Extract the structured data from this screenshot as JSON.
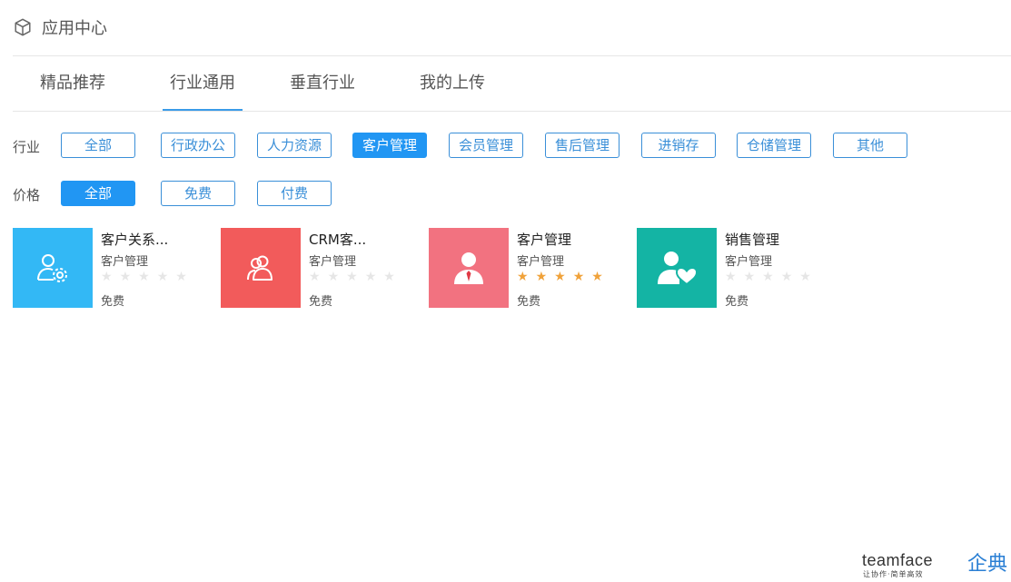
{
  "header": {
    "title": "应用中心",
    "icon": "cube-icon"
  },
  "tabs": [
    {
      "label": "精品推荐",
      "active": false
    },
    {
      "label": "行业通用",
      "active": true
    },
    {
      "label": "垂直行业",
      "active": false
    },
    {
      "label": "我的上传",
      "active": false
    }
  ],
  "filters": {
    "industry": {
      "label": "行业",
      "options": [
        "全部",
        "行政办公",
        "人力资源",
        "客户管理",
        "会员管理",
        "售后管理",
        "进销存",
        "仓储管理",
        "其他"
      ],
      "selected": "客户管理"
    },
    "price": {
      "label": "价格",
      "options": [
        "全部",
        "免费",
        "付费"
      ],
      "selected": "全部"
    }
  },
  "apps": [
    {
      "name": "客户关系...",
      "category": "客户管理",
      "rating": 0,
      "max_rating": 5,
      "price": "免费",
      "color": "#33b8f5",
      "icon": "user-settings-icon"
    },
    {
      "name": "CRM客...",
      "category": "客户管理",
      "rating": 0,
      "max_rating": 5,
      "price": "免费",
      "color": "#f25b5b",
      "icon": "users-icon"
    },
    {
      "name": "客户管理",
      "category": "客户管理",
      "rating": 5,
      "max_rating": 5,
      "price": "免费",
      "color": "#f27280",
      "icon": "businessman-icon"
    },
    {
      "name": "销售管理",
      "category": "客户管理",
      "rating": 0,
      "max_rating": 5,
      "price": "免费",
      "color": "#14b4a4",
      "icon": "user-heart-icon"
    }
  ],
  "brand": {
    "name": "teamface",
    "chinese": "企典",
    "slogan": "让协作·简单高效"
  },
  "colors": {
    "accent": "#2196f3",
    "star_on": "#f0a23a",
    "star_off": "#e6e6e6"
  }
}
